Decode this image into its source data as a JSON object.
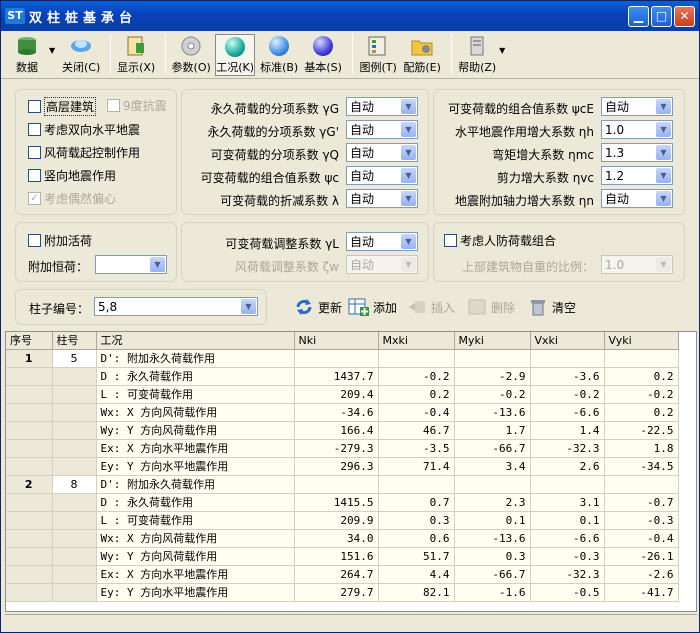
{
  "window": {
    "app_icon": "ST",
    "title": "双柱桩基承台"
  },
  "toolbar": [
    {
      "label": "数据",
      "icon": "database-icon",
      "has_drop": true
    },
    {
      "label": "关闭(C)",
      "icon": "close-disc-icon"
    },
    {
      "label": "显示(X)",
      "icon": "display-icon"
    },
    {
      "label": "参数(O)",
      "icon": "cd-icon"
    },
    {
      "label": "工况(K)",
      "icon": "teal-ball-icon",
      "selected": true
    },
    {
      "label": "标准(B)",
      "icon": "blue-ball-icon"
    },
    {
      "label": "基本(S)",
      "icon": "indigo-ball-icon"
    },
    {
      "label": "图例(T)",
      "icon": "legend-icon"
    },
    {
      "label": "配筋(E)",
      "icon": "rebar-folder-icon"
    },
    {
      "label": "帮助(Z)",
      "icon": "help-icon",
      "has_drop": true
    }
  ],
  "options": {
    "high_building": "高层建筑",
    "deg9": "9度抗震",
    "bi_horiz": "考虑双向水平地震",
    "wind_ctrl": "风荷载起控制作用",
    "vertical_quake": "竖向地震作用",
    "eccentric": "考虑偶然偏心"
  },
  "coef_mid": [
    {
      "label": "永久荷载的分项系数 γG",
      "value": "自动"
    },
    {
      "label": "永久荷载的分项系数 γG'",
      "value": "自动"
    },
    {
      "label": "可变荷载的分项系数 γQ",
      "value": "自动"
    },
    {
      "label": "可变荷载的组合值系数 ψc",
      "value": "自动"
    },
    {
      "label": "可变荷载的折减系数 λ",
      "value": "自动"
    }
  ],
  "coef_right": [
    {
      "label": "可变荷载的组合值系数 ψcE",
      "value": "自动"
    },
    {
      "label": "水平地震作用增大系数 ηh",
      "value": "1.0"
    },
    {
      "label": "弯矩增大系数 ηmc",
      "value": "1.3"
    },
    {
      "label": "剪力增大系数 ηvc",
      "value": "1.2"
    },
    {
      "label": "地震附加轴力增大系数 ηn",
      "value": "自动"
    }
  ],
  "live": {
    "add_live": "附加活荷",
    "add_dead": "附加恒荷：",
    "add_dead_value": ""
  },
  "adjust": {
    "live_label": "可变荷载调整系数 γL",
    "live_value": "自动",
    "wind_label": "风荷载调整系数 ζw",
    "wind_value": "自动"
  },
  "civil": {
    "label": "考虑人防荷载组合",
    "ratio_label": "上部建筑物自重的比例：",
    "ratio_value": "1.0"
  },
  "column": {
    "label": "柱子编号：",
    "value": "5,8"
  },
  "actions": {
    "update": "更新",
    "add": "添加",
    "insert": "插入",
    "delete": "删除",
    "clear": "清空"
  },
  "table": {
    "headers": [
      "序号",
      "柱号",
      "工况",
      "Nki",
      "Mxki",
      "Myki",
      "Vxki",
      "Vyki"
    ],
    "groups": [
      {
        "no": "1",
        "col": "5",
        "rows": [
          [
            "D': 附加永久荷载作用",
            "",
            "",
            "",
            "",
            ""
          ],
          [
            "D : 永久荷载作用",
            "1437.7",
            "-0.2",
            "-2.9",
            "-3.6",
            "0.2"
          ],
          [
            "L : 可变荷载作用",
            "209.4",
            "0.2",
            "-0.2",
            "-0.2",
            "-0.2"
          ],
          [
            "Wx: X 方向风荷载作用",
            "-34.6",
            "-0.4",
            "-13.6",
            "-6.6",
            "0.2"
          ],
          [
            "Wy: Y 方向风荷载作用",
            "166.4",
            "46.7",
            "1.7",
            "1.4",
            "-22.5"
          ],
          [
            "Ex: X 方向水平地震作用",
            "-279.3",
            "-3.5",
            "-66.7",
            "-32.3",
            "1.8"
          ],
          [
            "Ey: Y 方向水平地震作用",
            "296.3",
            "71.4",
            "3.4",
            "2.6",
            "-34.5"
          ]
        ]
      },
      {
        "no": "2",
        "col": "8",
        "rows": [
          [
            "D': 附加永久荷载作用",
            "",
            "",
            "",
            "",
            ""
          ],
          [
            "D : 永久荷载作用",
            "1415.5",
            "0.7",
            "2.3",
            "3.1",
            "-0.7"
          ],
          [
            "L : 可变荷载作用",
            "209.9",
            "0.3",
            "0.1",
            "0.1",
            "-0.3"
          ],
          [
            "Wx: X 方向风荷载作用",
            "34.0",
            "0.6",
            "-13.6",
            "-6.6",
            "-0.4"
          ],
          [
            "Wy: Y 方向风荷载作用",
            "151.6",
            "51.7",
            "0.3",
            "-0.3",
            "-26.1"
          ],
          [
            "Ex: X 方向水平地震作用",
            "264.7",
            "4.4",
            "-66.7",
            "-32.3",
            "-2.6"
          ],
          [
            "Ey: Y 方向水平地震作用",
            "279.7",
            "82.1",
            "-1.6",
            "-0.5",
            "-41.7"
          ]
        ]
      }
    ]
  }
}
